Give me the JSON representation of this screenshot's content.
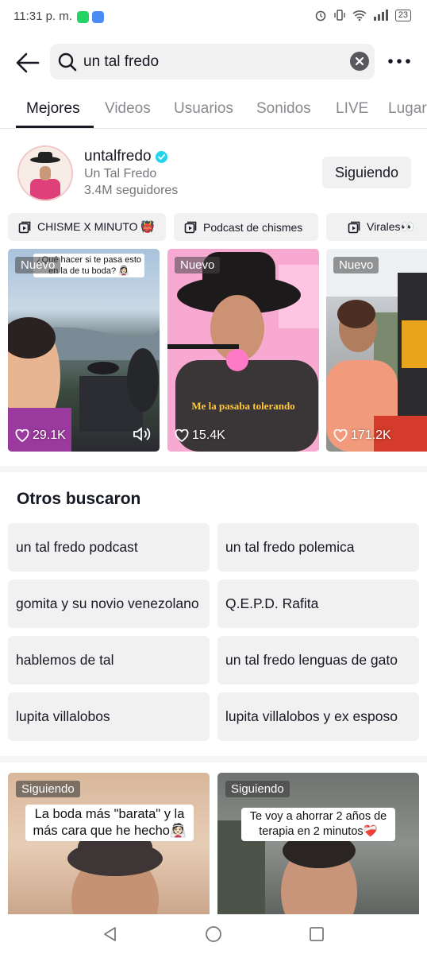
{
  "status_bar": {
    "time": "11:31 p. m.",
    "battery": "23"
  },
  "search": {
    "query": "un tal fredo"
  },
  "tabs": [
    {
      "label": "Mejores",
      "active": true
    },
    {
      "label": "Videos"
    },
    {
      "label": "Usuarios"
    },
    {
      "label": "Sonidos"
    },
    {
      "label": "LIVE"
    },
    {
      "label": "Lugar"
    }
  ],
  "user": {
    "username": "untalfredo",
    "display_name": "Un Tal Fredo",
    "followers": "3.4M seguidores",
    "follow_label": "Siguiendo"
  },
  "playlists": [
    {
      "label": "CHISME X MINUTO 👹"
    },
    {
      "label": "Podcast de chismes"
    },
    {
      "label": "Virales👀"
    }
  ],
  "videos": [
    {
      "badge": "Nuevo",
      "likes": "29.1K",
      "caption": "¿Qué hacer si te pasa esto en la de tu boda? 👰🏻‍♀️"
    },
    {
      "badge": "Nuevo",
      "likes": "15.4K",
      "caption": "Me la pasaba tolerando"
    },
    {
      "badge": "Nuevo",
      "likes": "171.2K"
    }
  ],
  "others_searched": {
    "title": "Otros buscaron",
    "items": [
      "un tal fredo podcast",
      "un tal fredo polemica",
      "gomita y su novio venezolano",
      "Q.E.P.D. Rafita",
      "hablemos de tal",
      "un tal fredo lenguas de gato",
      "lupita villalobos",
      "lupita villalobos y ex esposo"
    ]
  },
  "feed": [
    {
      "badge": "Siguiendo",
      "caption": "La boda más \"barata\" y la más cara que he hecho👰🏻"
    },
    {
      "badge": "Siguiendo",
      "caption": "Te voy a ahorrar 2 años de terapia en 2 minutos❤️‍🩹"
    }
  ],
  "colors": {
    "verified": "#20d5ec",
    "text": "#161823",
    "muted": "#8a8b91",
    "chip_bg": "#f1f1f2"
  }
}
